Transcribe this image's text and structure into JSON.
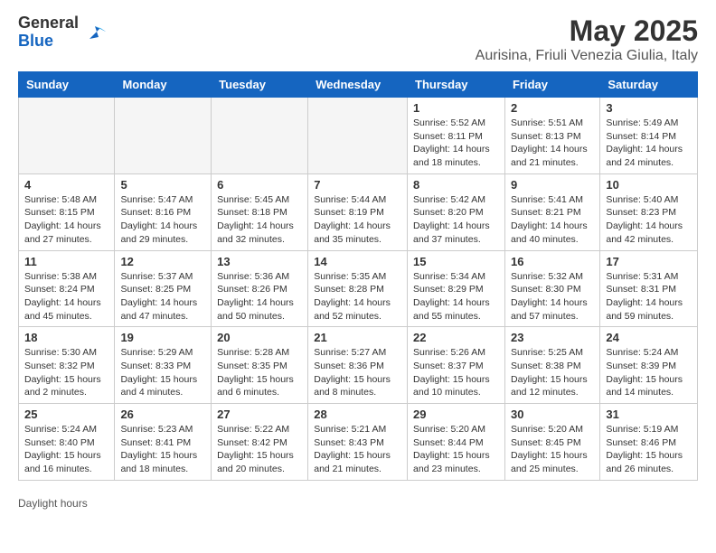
{
  "header": {
    "logo_general": "General",
    "logo_blue": "Blue",
    "main_title": "May 2025",
    "subtitle": "Aurisina, Friuli Venezia Giulia, Italy"
  },
  "days_of_week": [
    "Sunday",
    "Monday",
    "Tuesday",
    "Wednesday",
    "Thursday",
    "Friday",
    "Saturday"
  ],
  "footer": {
    "daylight_label": "Daylight hours"
  },
  "weeks": [
    {
      "days": [
        {
          "number": "",
          "info": "",
          "empty": true
        },
        {
          "number": "",
          "info": "",
          "empty": true
        },
        {
          "number": "",
          "info": "",
          "empty": true
        },
        {
          "number": "",
          "info": "",
          "empty": true
        },
        {
          "number": "1",
          "info": "Sunrise: 5:52 AM\nSunset: 8:11 PM\nDaylight: 14 hours\nand 18 minutes."
        },
        {
          "number": "2",
          "info": "Sunrise: 5:51 AM\nSunset: 8:13 PM\nDaylight: 14 hours\nand 21 minutes."
        },
        {
          "number": "3",
          "info": "Sunrise: 5:49 AM\nSunset: 8:14 PM\nDaylight: 14 hours\nand 24 minutes."
        }
      ]
    },
    {
      "days": [
        {
          "number": "4",
          "info": "Sunrise: 5:48 AM\nSunset: 8:15 PM\nDaylight: 14 hours\nand 27 minutes."
        },
        {
          "number": "5",
          "info": "Sunrise: 5:47 AM\nSunset: 8:16 PM\nDaylight: 14 hours\nand 29 minutes."
        },
        {
          "number": "6",
          "info": "Sunrise: 5:45 AM\nSunset: 8:18 PM\nDaylight: 14 hours\nand 32 minutes."
        },
        {
          "number": "7",
          "info": "Sunrise: 5:44 AM\nSunset: 8:19 PM\nDaylight: 14 hours\nand 35 minutes."
        },
        {
          "number": "8",
          "info": "Sunrise: 5:42 AM\nSunset: 8:20 PM\nDaylight: 14 hours\nand 37 minutes."
        },
        {
          "number": "9",
          "info": "Sunrise: 5:41 AM\nSunset: 8:21 PM\nDaylight: 14 hours\nand 40 minutes."
        },
        {
          "number": "10",
          "info": "Sunrise: 5:40 AM\nSunset: 8:23 PM\nDaylight: 14 hours\nand 42 minutes."
        }
      ]
    },
    {
      "days": [
        {
          "number": "11",
          "info": "Sunrise: 5:38 AM\nSunset: 8:24 PM\nDaylight: 14 hours\nand 45 minutes."
        },
        {
          "number": "12",
          "info": "Sunrise: 5:37 AM\nSunset: 8:25 PM\nDaylight: 14 hours\nand 47 minutes."
        },
        {
          "number": "13",
          "info": "Sunrise: 5:36 AM\nSunset: 8:26 PM\nDaylight: 14 hours\nand 50 minutes."
        },
        {
          "number": "14",
          "info": "Sunrise: 5:35 AM\nSunset: 8:28 PM\nDaylight: 14 hours\nand 52 minutes."
        },
        {
          "number": "15",
          "info": "Sunrise: 5:34 AM\nSunset: 8:29 PM\nDaylight: 14 hours\nand 55 minutes."
        },
        {
          "number": "16",
          "info": "Sunrise: 5:32 AM\nSunset: 8:30 PM\nDaylight: 14 hours\nand 57 minutes."
        },
        {
          "number": "17",
          "info": "Sunrise: 5:31 AM\nSunset: 8:31 PM\nDaylight: 14 hours\nand 59 minutes."
        }
      ]
    },
    {
      "days": [
        {
          "number": "18",
          "info": "Sunrise: 5:30 AM\nSunset: 8:32 PM\nDaylight: 15 hours\nand 2 minutes."
        },
        {
          "number": "19",
          "info": "Sunrise: 5:29 AM\nSunset: 8:33 PM\nDaylight: 15 hours\nand 4 minutes."
        },
        {
          "number": "20",
          "info": "Sunrise: 5:28 AM\nSunset: 8:35 PM\nDaylight: 15 hours\nand 6 minutes."
        },
        {
          "number": "21",
          "info": "Sunrise: 5:27 AM\nSunset: 8:36 PM\nDaylight: 15 hours\nand 8 minutes."
        },
        {
          "number": "22",
          "info": "Sunrise: 5:26 AM\nSunset: 8:37 PM\nDaylight: 15 hours\nand 10 minutes."
        },
        {
          "number": "23",
          "info": "Sunrise: 5:25 AM\nSunset: 8:38 PM\nDaylight: 15 hours\nand 12 minutes."
        },
        {
          "number": "24",
          "info": "Sunrise: 5:24 AM\nSunset: 8:39 PM\nDaylight: 15 hours\nand 14 minutes."
        }
      ]
    },
    {
      "days": [
        {
          "number": "25",
          "info": "Sunrise: 5:24 AM\nSunset: 8:40 PM\nDaylight: 15 hours\nand 16 minutes."
        },
        {
          "number": "26",
          "info": "Sunrise: 5:23 AM\nSunset: 8:41 PM\nDaylight: 15 hours\nand 18 minutes."
        },
        {
          "number": "27",
          "info": "Sunrise: 5:22 AM\nSunset: 8:42 PM\nDaylight: 15 hours\nand 20 minutes."
        },
        {
          "number": "28",
          "info": "Sunrise: 5:21 AM\nSunset: 8:43 PM\nDaylight: 15 hours\nand 21 minutes."
        },
        {
          "number": "29",
          "info": "Sunrise: 5:20 AM\nSunset: 8:44 PM\nDaylight: 15 hours\nand 23 minutes."
        },
        {
          "number": "30",
          "info": "Sunrise: 5:20 AM\nSunset: 8:45 PM\nDaylight: 15 hours\nand 25 minutes."
        },
        {
          "number": "31",
          "info": "Sunrise: 5:19 AM\nSunset: 8:46 PM\nDaylight: 15 hours\nand 26 minutes."
        }
      ]
    }
  ]
}
